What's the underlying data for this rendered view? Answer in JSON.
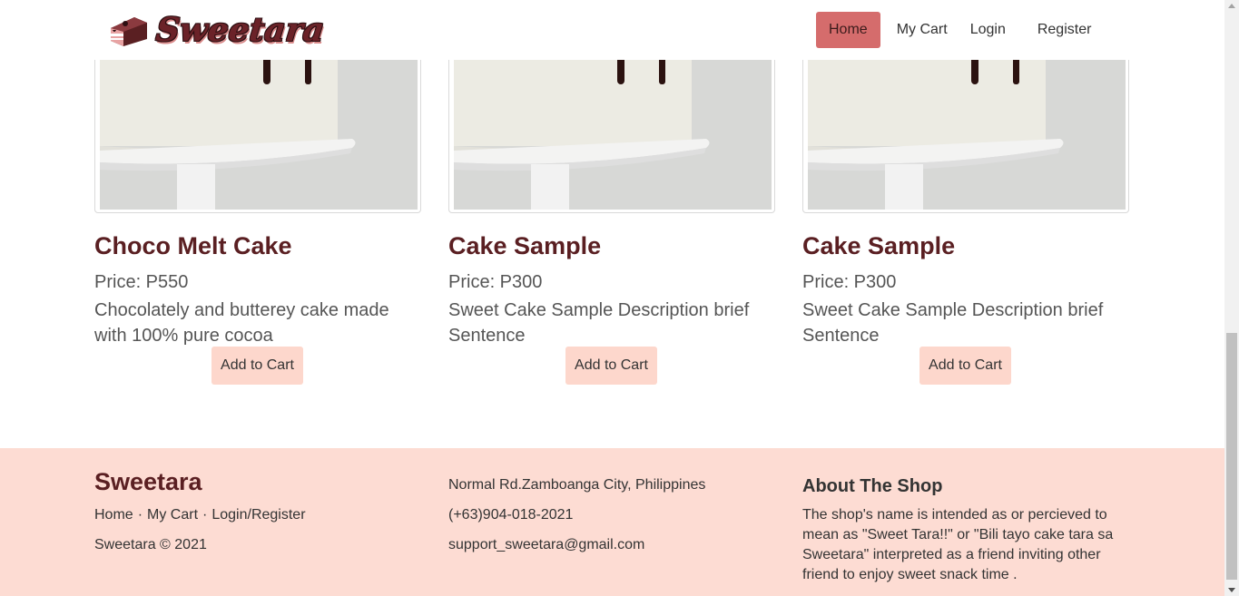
{
  "header": {
    "brand": "Sweetara",
    "nav": [
      {
        "label": "Home",
        "active": true
      },
      {
        "label": "My Cart"
      },
      {
        "label": "Login"
      },
      {
        "label": "Register"
      }
    ]
  },
  "products": [
    {
      "title": "Choco Melt Cake",
      "price": "Price: P550",
      "description": "Chocolately and butterey cake made with 100% pure cocoa",
      "button": "Add to Cart"
    },
    {
      "title": "Cake Sample",
      "price": "Price: P300",
      "description": "Sweet Cake Sample Description brief Sentence",
      "button": "Add to Cart"
    },
    {
      "title": "Cake Sample",
      "price": "Price: P300",
      "description": "Sweet Cake Sample Description brief Sentence",
      "button": "Add to Cart"
    }
  ],
  "footer": {
    "brand": "Sweetara",
    "links": [
      "Home",
      "My Cart",
      "Login/Register"
    ],
    "separator": "·",
    "copyright": "Sweetara © 2021",
    "address": "Normal Rd.Zamboanga City, Philippines",
    "phone": "(+63)904-018-2021",
    "email": "support_sweetara@gmail.com",
    "about_title": "About The Shop",
    "about_text": "The shop's name is intended as or percieved to mean as \"Sweet Tara!!\" or \"Bili tayo cake tara sa Sweetara\" interpreted as a friend inviting other friend to enjoy sweet snack time ."
  },
  "colors": {
    "accent": "#d56c6c",
    "button_bg": "#fdd7cc",
    "footer_bg": "#fddcd3",
    "title": "#5a1f22"
  }
}
